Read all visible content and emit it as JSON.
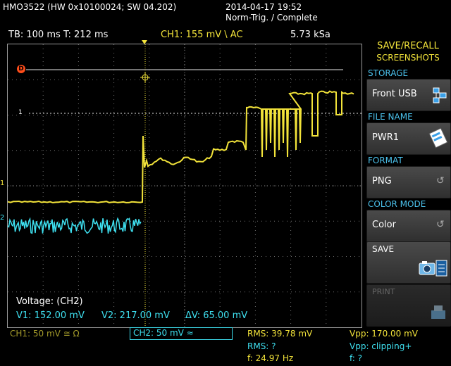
{
  "header": {
    "device": "HMO3522 (HW 0x10100024; SW 04.202)",
    "datetime": "2014-04-17 19:52",
    "trigger_status": "Norm-Trig. / Complete"
  },
  "info_bar": {
    "timebase": "TB: 100 ms",
    "time": "T: 212 ms",
    "ch1_trigger": "CH1: 155 mV \\ AC",
    "sample_rate": "5.73 kSa"
  },
  "side_panel": {
    "title_line1": "SAVE/RECALL",
    "title_line2": "SCREENSHOTS",
    "storage_label": "STORAGE",
    "storage_value": "Front USB",
    "filename_label": "FILE NAME",
    "filename_value": "PWR1",
    "format_label": "FORMAT",
    "format_value": "PNG",
    "colormode_label": "COLOR MODE",
    "colormode_value": "Color",
    "save_label": "SAVE",
    "print_label": "PRINT"
  },
  "cursor_readout": {
    "title": "Voltage: (CH2)",
    "v1": "V1: 152.00 mV",
    "v2": "V2: 217.00 mV",
    "dv": "ΔV: 65.00 mV"
  },
  "channels": {
    "ch1": "CH1: 50 mV ≅ Ω",
    "ch2": "CH2: 50 mV ≈"
  },
  "measurements": {
    "rms1": "RMS: 39.78 mV",
    "vpp1": "Vpp: 170.00 mV",
    "rms2": "RMS: ?",
    "vpp2": "Vpp: clipping+",
    "f1": "f: 24.97 Hz",
    "f2": "f: ?"
  },
  "markers": {
    "ref_marker": "D",
    "ch1_level": "1",
    "ch2_level": "2",
    "ch1_offset": "1"
  },
  "colors": {
    "ch1": "#f2e33a",
    "ch2": "#3ee0f0",
    "panel_heading": "#4cc3ee",
    "marker": "#ff4d1a"
  }
}
